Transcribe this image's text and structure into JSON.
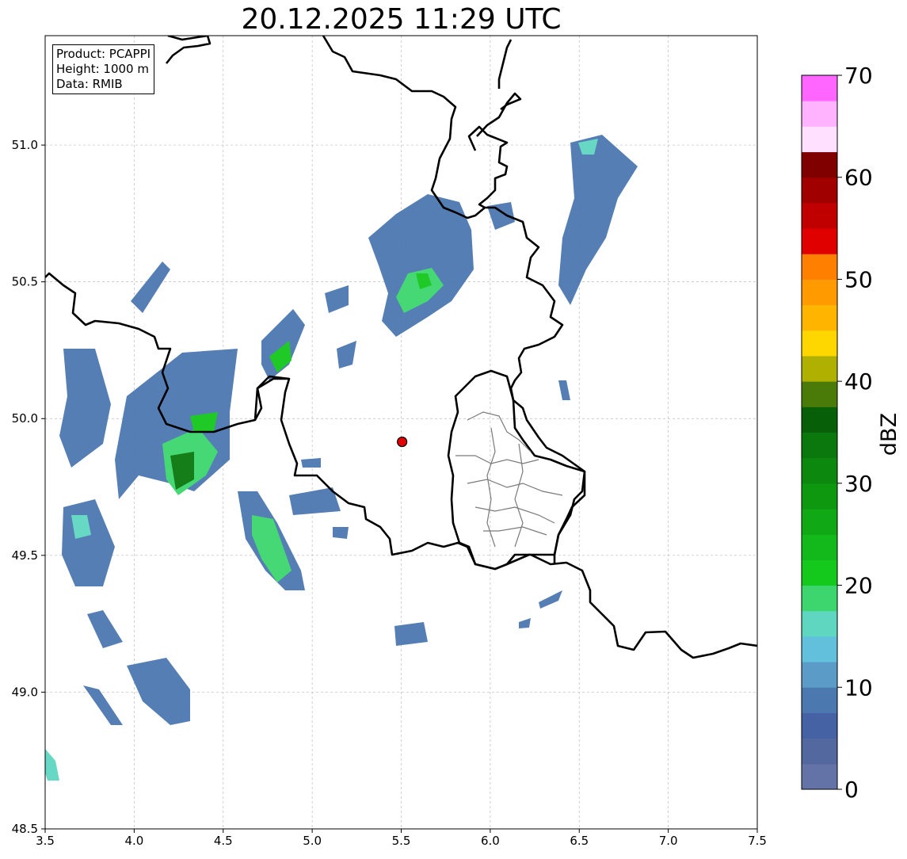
{
  "title": "20.12.2025 11:29 UTC",
  "info": {
    "product": "Product: PCAPPI",
    "height": "Height: 1000 m",
    "source": "Data: RMIB"
  },
  "axes": {
    "x_ticks": [
      "3.5",
      "4.0",
      "4.5",
      "5.0",
      "5.5",
      "6.0",
      "6.5",
      "7.0",
      "7.5"
    ],
    "y_ticks": [
      "48.5",
      "49.0",
      "49.5",
      "50.0",
      "50.5",
      "51.0"
    ],
    "xlim": [
      3.5,
      7.5
    ],
    "ylim": [
      48.5,
      51.4
    ],
    "grid": true
  },
  "radar_site": {
    "lon": 5.505,
    "lat": 49.915,
    "color": "#e00000"
  },
  "colorbar": {
    "label": "dBZ",
    "ticks": [
      "0",
      "10",
      "20",
      "30",
      "40",
      "50",
      "60",
      "70"
    ],
    "min": 0,
    "max": 70,
    "step": 2.5,
    "colors": [
      "#6373a8",
      "#52689f",
      "#4462a4",
      "#4c78b0",
      "#5a9bc8",
      "#62c0dc",
      "#5ed6c0",
      "#3dd66e",
      "#14c81c",
      "#13b81a",
      "#10a814",
      "#0e9810",
      "#0c880e",
      "#0a780c",
      "#075f08",
      "#4a7a08",
      "#b0b000",
      "#ffd700",
      "#ffb400",
      "#ff9a00",
      "#ff7f00",
      "#e00000",
      "#c00000",
      "#a00000",
      "#800000",
      "#ffe0ff",
      "#ffb3ff",
      "#ff66ff",
      "#ee33ee"
    ]
  }
}
